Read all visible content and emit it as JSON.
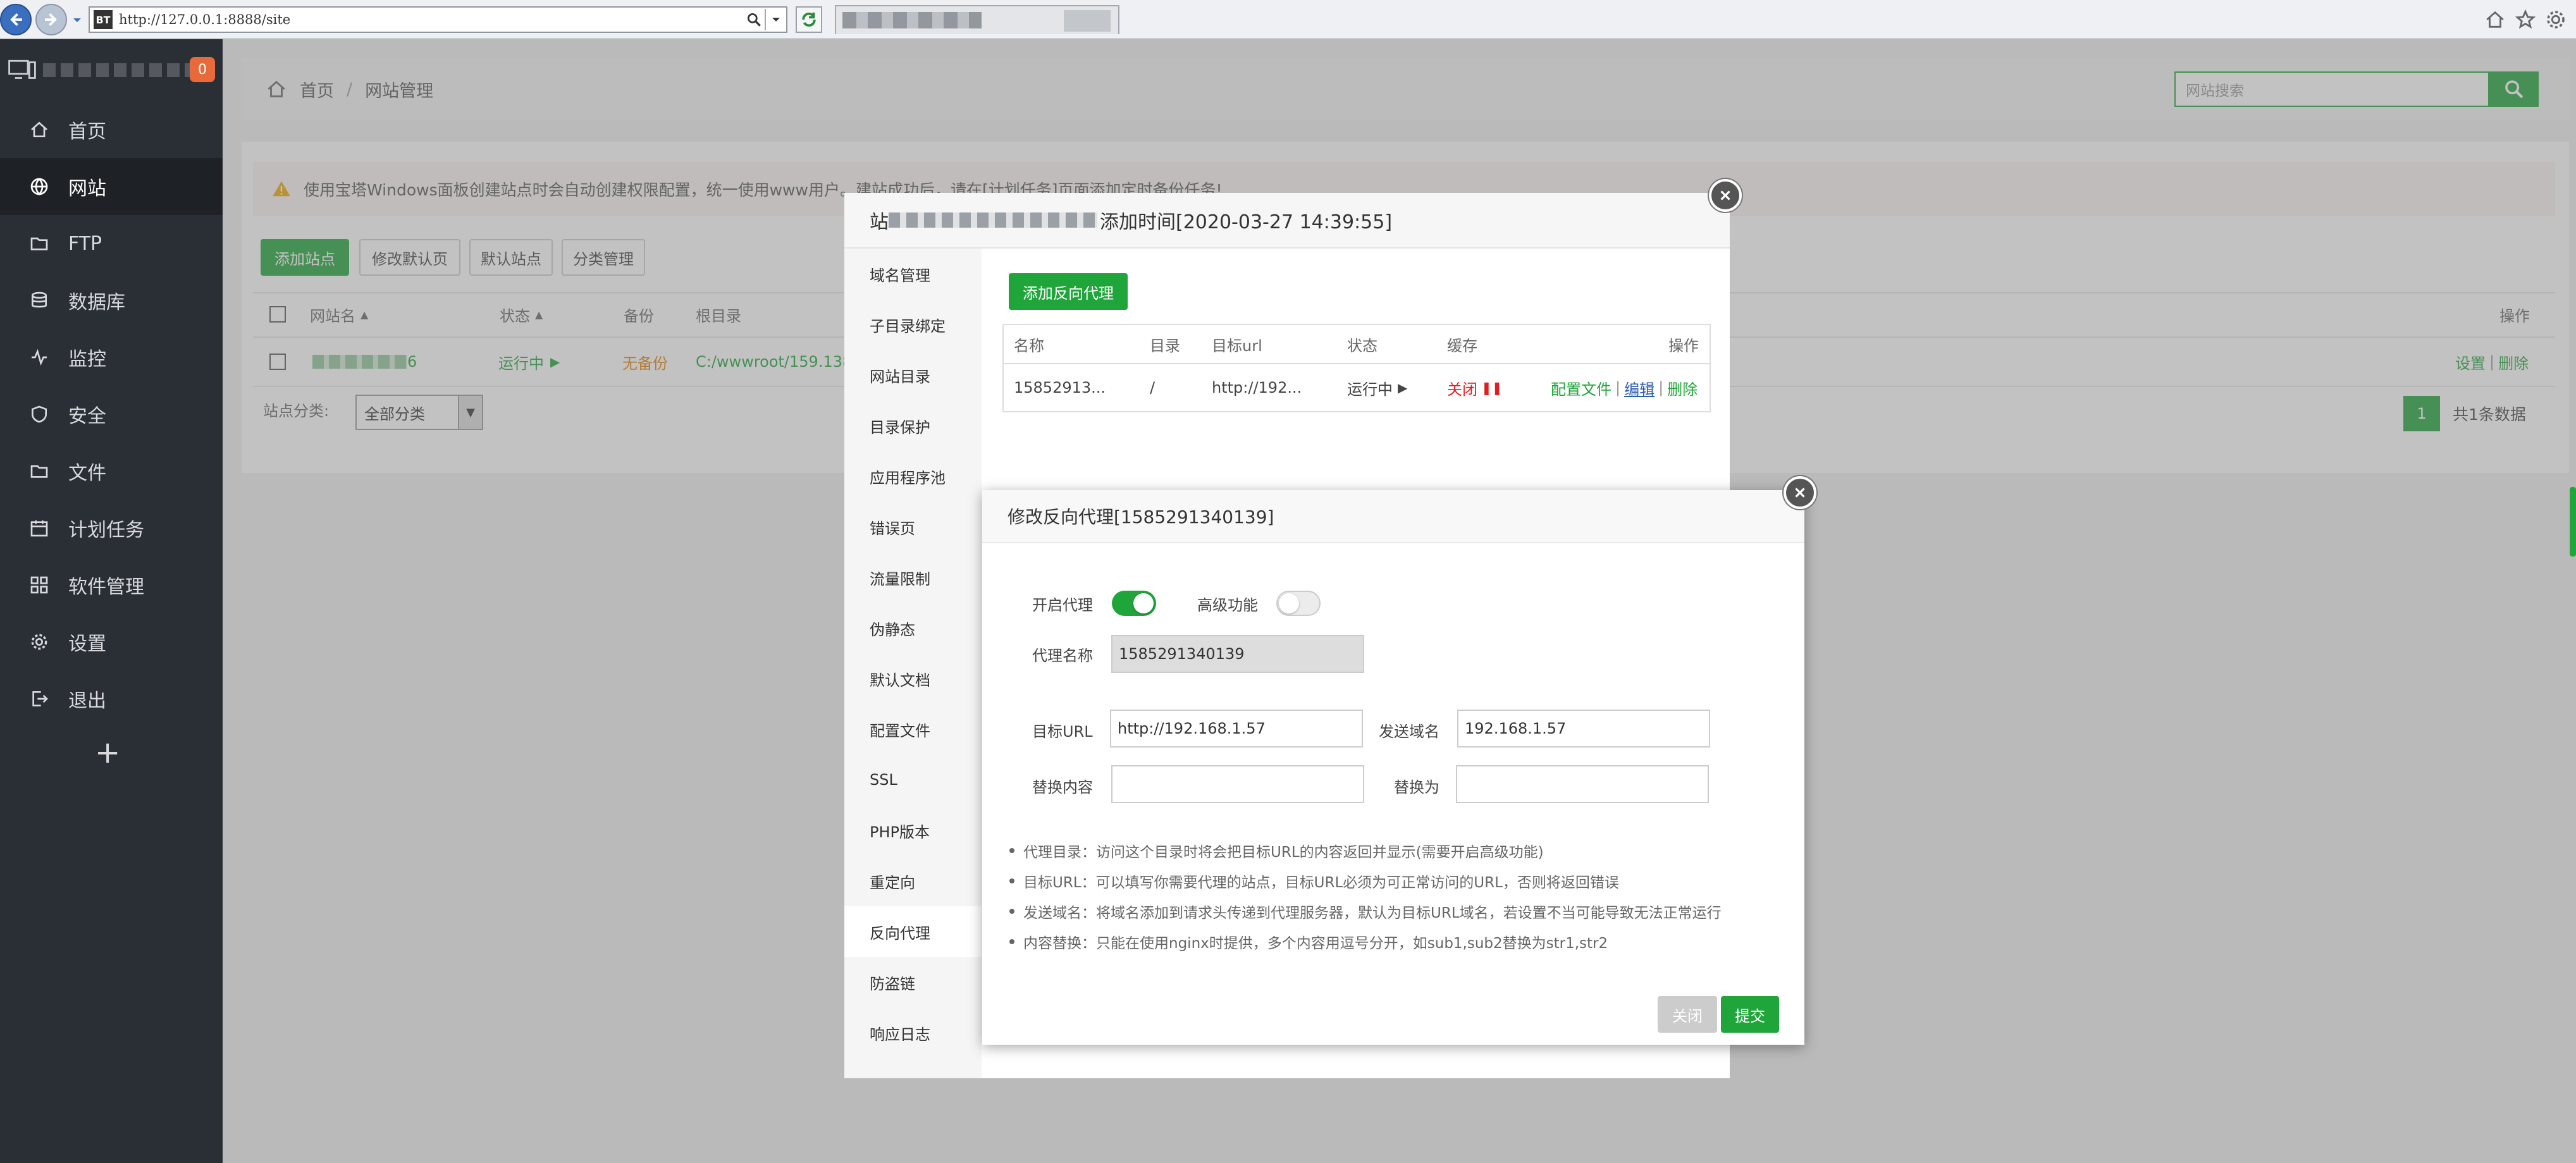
{
  "browser": {
    "url": "http://127.0.0.1:8888/site",
    "tab_icon_text": "BT"
  },
  "sidebar": {
    "badge": "0",
    "items": [
      {
        "label": "首页",
        "icon": "home-icon"
      },
      {
        "label": "网站",
        "icon": "globe-icon"
      },
      {
        "label": "FTP",
        "icon": "ftp-icon"
      },
      {
        "label": "数据库",
        "icon": "database-icon"
      },
      {
        "label": "监控",
        "icon": "monitor-icon"
      },
      {
        "label": "安全",
        "icon": "shield-icon"
      },
      {
        "label": "文件",
        "icon": "folder-icon"
      },
      {
        "label": "计划任务",
        "icon": "calendar-icon"
      },
      {
        "label": "软件管理",
        "icon": "apps-icon"
      },
      {
        "label": "设置",
        "icon": "gear-icon"
      },
      {
        "label": "退出",
        "icon": "logout-icon"
      }
    ],
    "active_index": 1,
    "add": "+"
  },
  "header": {
    "breadcrumb_home": "首页",
    "breadcrumb_sep": "/",
    "breadcrumb_current": "网站管理",
    "search_placeholder": "网站搜索"
  },
  "main": {
    "warning": "使用宝塔Windows面板创建站点时会自动创建权限配置，统一使用www用户。建站成功后，请在[计划任务]页面添加定时备份任务!",
    "buttons": [
      "添加站点",
      "修改默认页",
      "默认站点",
      "分类管理"
    ],
    "columns": {
      "name": "网站名",
      "status": "状态",
      "backup": "备份",
      "root": "根目录",
      "ops": "操作"
    },
    "row": {
      "name_suffix": "6",
      "status": "运行中",
      "backup": "无备份",
      "root": "C:/wwwroot/159.138",
      "op_set": "设置",
      "op_del": "删除",
      "sep": "|"
    },
    "category_label": "站点分类:",
    "category_value": "全部分类",
    "page": "1",
    "total": "共1条数据"
  },
  "site_modal": {
    "title_suffix": "添加时间[2020-03-27 14:39:55]",
    "nav": [
      "域名管理",
      "子目录绑定",
      "网站目录",
      "目录保护",
      "应用程序池",
      "错误页",
      "流量限制",
      "伪静态",
      "默认文档",
      "配置文件",
      "SSL",
      "PHP版本",
      "重定向",
      "反向代理",
      "防盗链",
      "响应日志"
    ],
    "active_nav": 13,
    "add_proxy": "添加反向代理",
    "columns": [
      "名称",
      "目录",
      "目标url",
      "状态",
      "缓存",
      "操作"
    ],
    "row": {
      "name": "15852913...",
      "dir": "/",
      "url": "http://192...",
      "status": "运行中",
      "cache": "关闭",
      "op_config": "配置文件",
      "op_edit": "编辑",
      "op_del": "删除",
      "sep": "|"
    }
  },
  "proxy_modal": {
    "title": "修改反向代理[1585291340139]",
    "enable_label": "开启代理",
    "enable_on": true,
    "advanced_label": "高级功能",
    "advanced_on": false,
    "name_label": "代理名称",
    "name_value": "1585291340139",
    "target_url_label": "目标URL",
    "target_url_value": "http://192.168.1.57",
    "send_domain_label": "发送域名",
    "send_domain_value": "192.168.1.57",
    "replace_label": "替换内容",
    "replace_value": "",
    "replace_to_label": "替换为",
    "replace_to_value": "",
    "tips": [
      "代理目录：访问这个目录时将会把目标URL的内容返回并显示(需要开启高级功能)",
      "目标URL：可以填写你需要代理的站点，目标URL必须为可正常访问的URL，否则将返回错误",
      "发送域名：将域名添加到请求头传递到代理服务器，默认为目标URL域名，若设置不当可能导致无法正常运行",
      "内容替换：只能在使用nginx时提供，多个内容用逗号分开，如sub1,sub2替换为str1,str2"
    ],
    "close": "关闭",
    "submit": "提交"
  },
  "colors": {
    "accent": "#20a53a",
    "sidebar": "#2a2f35",
    "danger": "#e02020"
  }
}
